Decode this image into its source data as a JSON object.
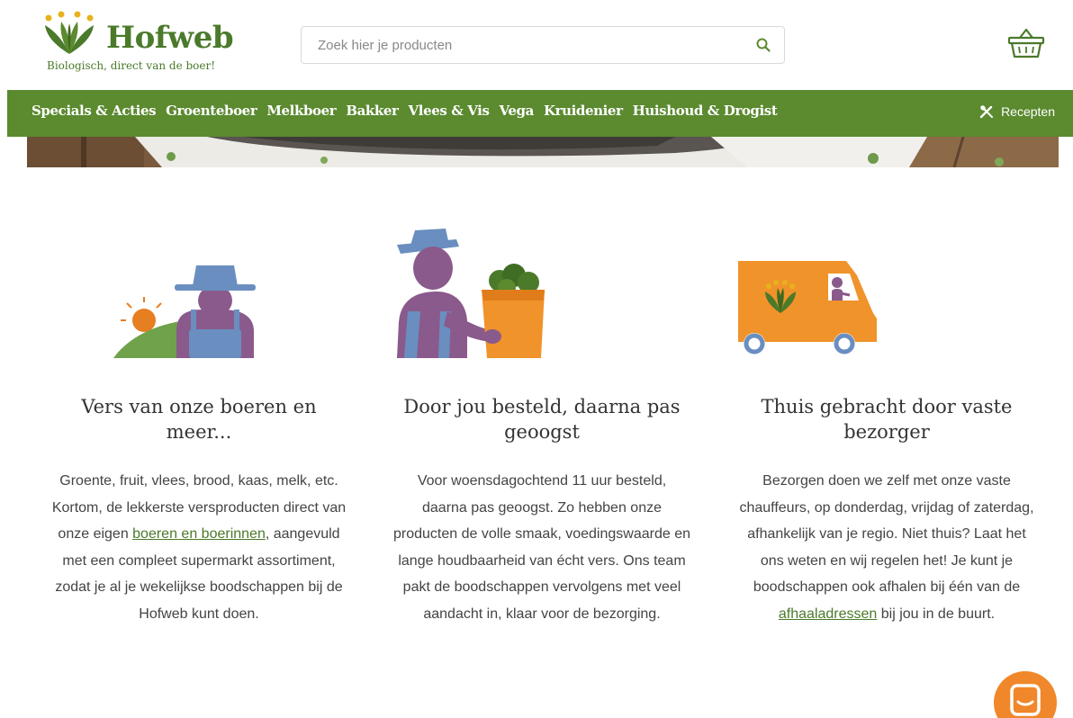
{
  "brand": {
    "name": "Hofweb",
    "tagline": "Biologisch, direct van de boer!",
    "green": "#5b8a2f",
    "orange": "#f0872a"
  },
  "search": {
    "placeholder": "Zoek hier je producten",
    "icon": "search-icon"
  },
  "cart": {
    "icon": "basket-icon"
  },
  "nav": {
    "items": [
      "Specials & Acties",
      "Groenteboer",
      "Melkboer",
      "Bakker",
      "Vlees & Vis",
      "Vega",
      "Kruidenier",
      "Huishoud & Drogist"
    ],
    "recepten": {
      "label": "Recepten",
      "icon": "cutlery-icon"
    }
  },
  "features": [
    {
      "title": "Vers van onze boeren en meer...",
      "text_before": "Groente, fruit, vlees, brood, kaas, melk, etc. Kortom, de lekkerste versproducten direct van onze eigen ",
      "link": "boeren en boerinnen",
      "text_after": ", aangevuld met een compleet supermarkt assortiment, zodat je al je wekelijkse boodschappen bij de Hofweb kunt doen.",
      "illustration": "farmer-illustration"
    },
    {
      "title": "Door jou besteld, daarna pas geoogst",
      "text_before": "Voor woensdagochtend 11 uur besteld, daarna pas geoogst. Zo hebben onze producten de volle smaak, voedingswaarde en lange houdbaarheid van écht vers. Ons team pakt de boodschappen vervolgens met veel aandacht in, klaar voor de bezorging.",
      "link": "",
      "text_after": "",
      "illustration": "harvest-illustration"
    },
    {
      "title": "Thuis gebracht door vaste bezorger",
      "text_before": "Bezorgen doen we zelf met onze vaste chauffeurs, op donderdag, vrijdag of zaterdag, afhankelijk van je regio. Niet thuis? Laat het ons weten en wij regelen het! Je kunt je boodschappen ook afhalen bij één van de ",
      "link": "afhaaladressen",
      "text_after": " bij jou in de buurt.",
      "illustration": "delivery-van-illustration"
    }
  ],
  "chat": {
    "icon": "chat-icon"
  }
}
